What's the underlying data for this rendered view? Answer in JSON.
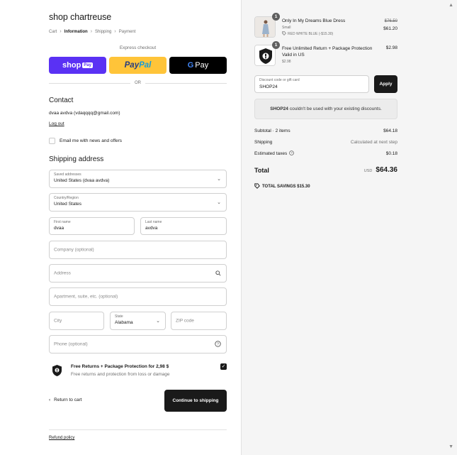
{
  "store": {
    "name": "shop chartreuse"
  },
  "breadcrumb": [
    "Cart",
    "Information",
    "Shipping",
    "Payment"
  ],
  "express": {
    "label": "Express checkout",
    "shop_pay": "shop",
    "shop_pay_badge": "Pay",
    "paypal_a": "Pay",
    "paypal_b": "Pal",
    "gpay_g": "G",
    "gpay_text": "Pay",
    "or": "OR"
  },
  "contact": {
    "heading": "Contact",
    "email": "dvaa avdva (vdaqqqq@gmail.com)",
    "logout": "Log out",
    "newsletter": "Email me with news and offers"
  },
  "shipping": {
    "heading": "Shipping address",
    "saved_label": "Saved addresses",
    "saved_value": "United States (dvaa avdva)",
    "country_label": "Country/Region",
    "country_value": "United States",
    "first_label": "First name",
    "first_value": "dvaa",
    "last_label": "Last name",
    "last_value": "avdva",
    "company_ph": "Company (optional)",
    "address_ph": "Address",
    "apartment_ph": "Apartment, suite, etc. (optional)",
    "city_ph": "City",
    "state_label": "State",
    "state_value": "Alabama",
    "zip_ph": "ZIP code",
    "phone_ph": "Phone (optional)"
  },
  "protection": {
    "title": "Free Returns + Package Protection for 2,98 $",
    "subtitle": "Free returns and protection from loss or damage",
    "checked": true
  },
  "actions": {
    "back": "Return to cart",
    "continue": "Continue to shipping",
    "refund": "Refund policy"
  },
  "order": {
    "items": [
      {
        "qty": "1",
        "title": "Only In My Dreams Blue Dress",
        "variant": "Small",
        "discount": "RED WHITE BLUE (-$15.30)",
        "old_price": "$76.50",
        "price": "$61.20"
      },
      {
        "qty": "1",
        "title": "Free Unlimited Return + Package Protection Valid in US",
        "variant": "$2.98",
        "price": "$2.98"
      }
    ],
    "discount_label": "Discount code or gift card",
    "discount_value": "SHOP24",
    "apply": "Apply",
    "notice_code": "SHOP24",
    "notice_text": "couldn't be used with your existing discounts.",
    "subtotal_label": "Subtotal · 2 items",
    "subtotal_value": "$64.18",
    "shipping_label": "Shipping",
    "shipping_value": "Calculated at next step",
    "taxes_label": "Estimated taxes",
    "taxes_value": "$0.18",
    "total_label": "Total",
    "currency": "USD",
    "total_value": "$64.36",
    "savings": "TOTAL SAVINGS  $15.30"
  },
  "colors": {
    "shop_pay": "#5a31f4",
    "paypal": "#ffc439",
    "dark": "#1a1a1a",
    "sidebar_bg": "#f5f5f5"
  }
}
